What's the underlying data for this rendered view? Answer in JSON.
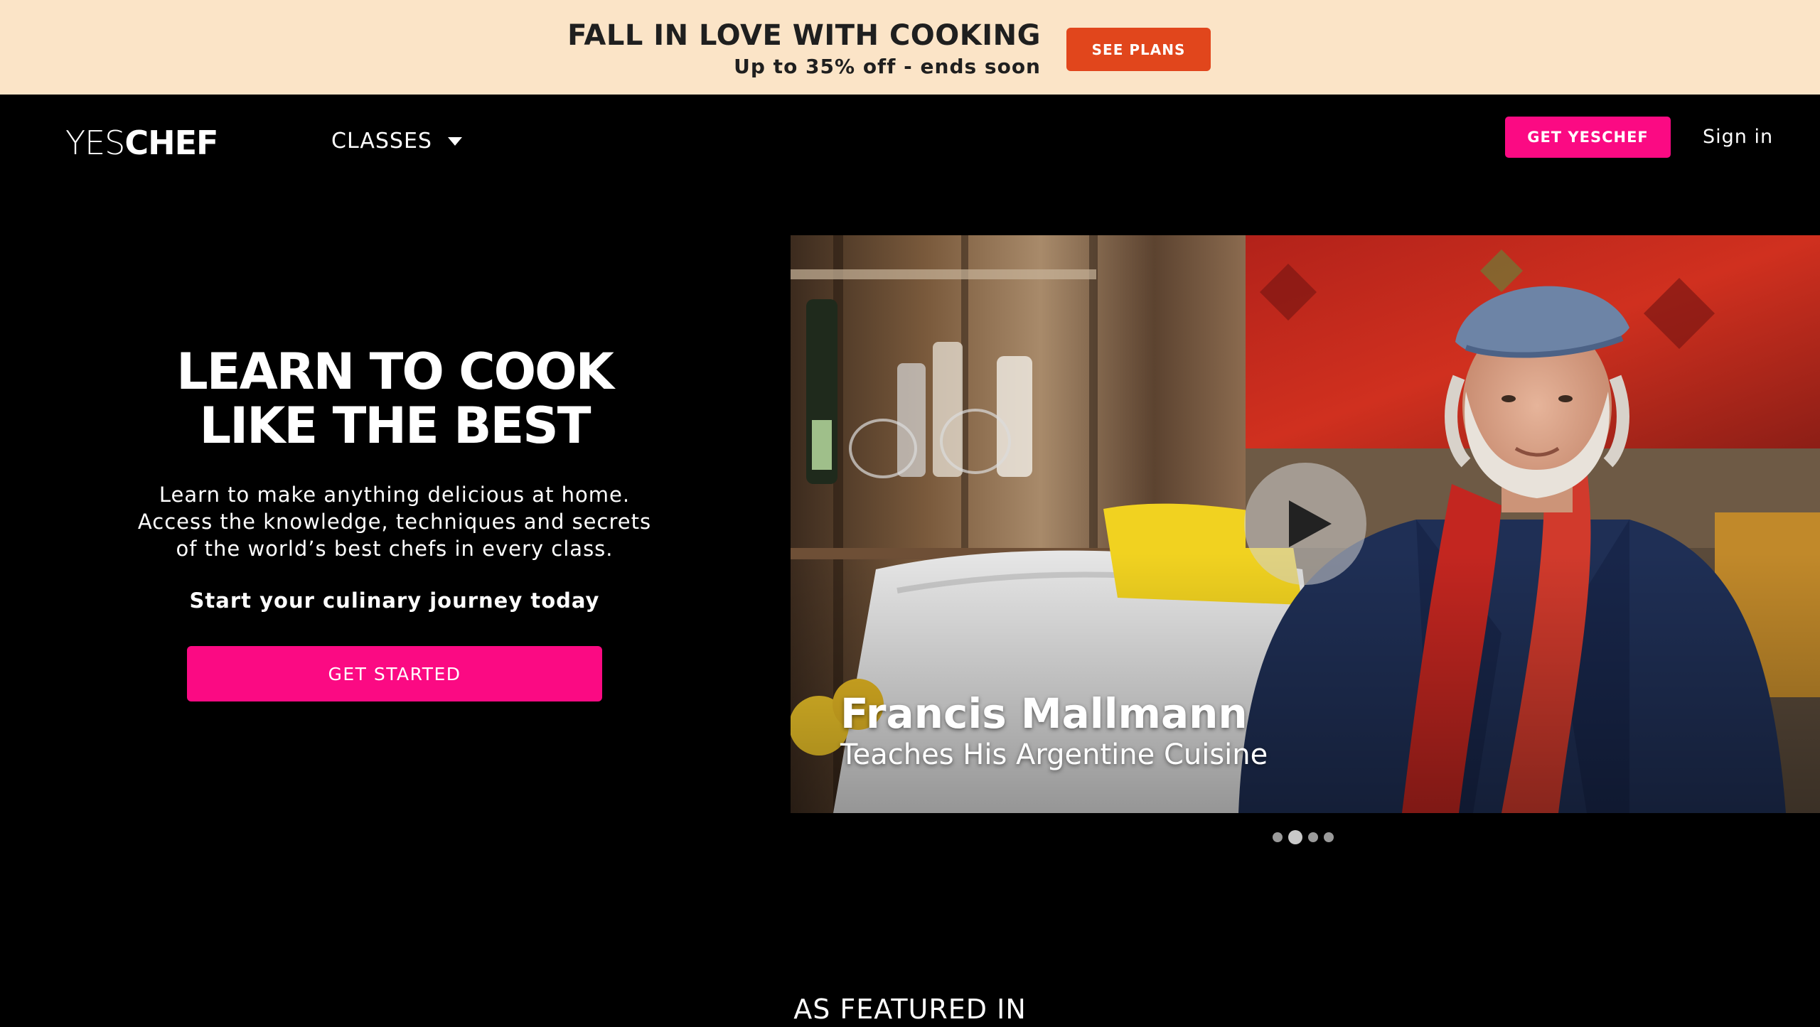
{
  "promo": {
    "title": "FALL IN LOVE WITH COOKING",
    "subtitle": "Up to 35% off - ends soon",
    "button_label": "SEE PLANS"
  },
  "nav": {
    "logo_light": "YES",
    "logo_bold": "CHEF",
    "classes_label": "CLASSES",
    "get_button_label": "GET YESCHEF",
    "signin_label": "Sign in"
  },
  "hero": {
    "title_line1": "LEARN TO COOK",
    "title_line2": "LIKE THE BEST",
    "desc_line1": "Learn to make anything delicious at home.",
    "desc_line2": "Access the knowledge, techniques and secrets",
    "desc_line3": "of the world’s best chefs in every class.",
    "cta_text": "Start your culinary journey today",
    "cta_button": "GET STARTED"
  },
  "video": {
    "chef_name": "Francis Mallmann",
    "chef_subtitle": "Teaches His Argentine Cuisine",
    "carousel_count": 4,
    "carousel_active": 2
  },
  "featured": {
    "heading": "AS FEATURED IN"
  },
  "colors": {
    "promo_bg": "#fbe4c7",
    "promo_button": "#e1461c",
    "accent_pink": "#fb0a83",
    "background": "#000000"
  }
}
